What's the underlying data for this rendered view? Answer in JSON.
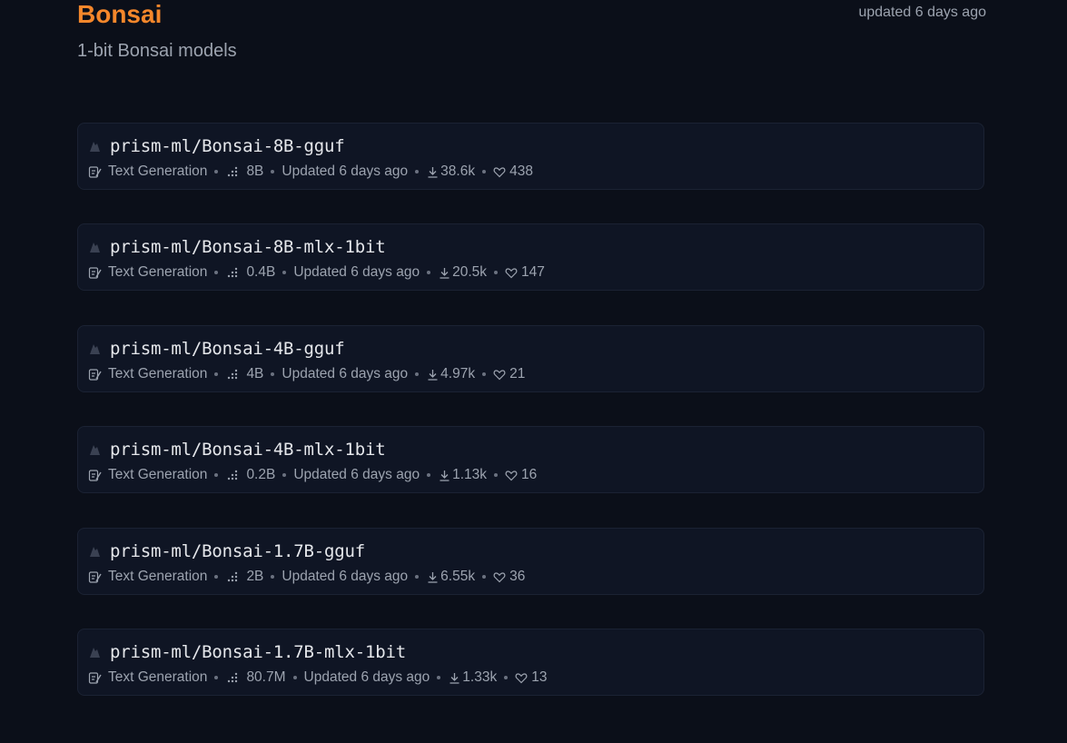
{
  "collection": {
    "title": "Bonsai",
    "subtitle": "1-bit Bonsai models",
    "updated": "updated 6 days ago"
  },
  "models": [
    {
      "name": "prism-ml/Bonsai-8B-gguf",
      "task": "Text Generation",
      "params": "8B",
      "updated": "Updated 6 days ago",
      "downloads": "38.6k",
      "likes": "438"
    },
    {
      "name": "prism-ml/Bonsai-8B-mlx-1bit",
      "task": "Text Generation",
      "params": "0.4B",
      "updated": "Updated 6 days ago",
      "downloads": "20.5k",
      "likes": "147"
    },
    {
      "name": "prism-ml/Bonsai-4B-gguf",
      "task": "Text Generation",
      "params": "4B",
      "updated": "Updated 6 days ago",
      "downloads": "4.97k",
      "likes": "21"
    },
    {
      "name": "prism-ml/Bonsai-4B-mlx-1bit",
      "task": "Text Generation",
      "params": "0.2B",
      "updated": "Updated 6 days ago",
      "downloads": "1.13k",
      "likes": "16"
    },
    {
      "name": "prism-ml/Bonsai-1.7B-gguf",
      "task": "Text Generation",
      "params": "2B",
      "updated": "Updated 6 days ago",
      "downloads": "6.55k",
      "likes": "36"
    },
    {
      "name": "prism-ml/Bonsai-1.7B-mlx-1bit",
      "task": "Text Generation",
      "params": "80.7M",
      "updated": "Updated 6 days ago",
      "downloads": "1.33k",
      "likes": "13"
    }
  ],
  "icons": {
    "avatar": "org-avatar-icon",
    "task": "text-generation-icon",
    "params": "parameters-icon",
    "downloads": "download-icon",
    "likes": "heart-icon"
  },
  "colors": {
    "accent": "#f5872b",
    "background": "#0b0f19",
    "card": "#0f1524"
  }
}
